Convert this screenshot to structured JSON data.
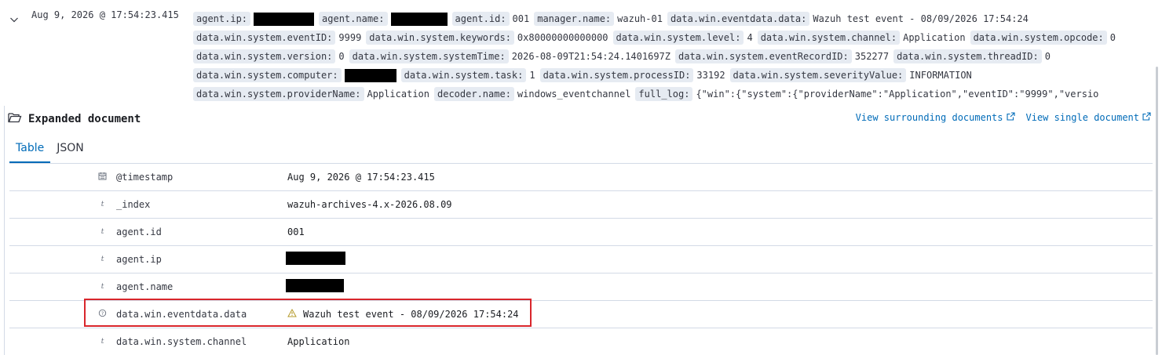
{
  "row": {
    "timestamp": "Aug 9, 2026 @ 17:54:23.415",
    "summary_lines": [
      [
        {
          "k": "agent.ip:",
          "redacted": true,
          "w": 77
        },
        {
          "k": "agent.name:",
          "redacted": true,
          "w": 72
        },
        {
          "k": "agent.id:",
          "v": "001"
        },
        {
          "k": "manager.name:",
          "v": "wazuh-01"
        },
        {
          "k": "data.win.eventdata.data:",
          "v": "Wazuh test event - 08/09/2026 17:54:24"
        }
      ],
      [
        {
          "k": "data.win.system.eventID:",
          "v": "9999"
        },
        {
          "k": "data.win.system.keywords:",
          "v": "0x80000000000000"
        },
        {
          "k": "data.win.system.level:",
          "v": "4"
        },
        {
          "k": "data.win.system.channel:",
          "v": "Application"
        },
        {
          "k": "data.win.system.opcode:",
          "v": "0"
        }
      ],
      [
        {
          "k": "data.win.system.version:",
          "v": "0"
        },
        {
          "k": "data.win.system.systemTime:",
          "v": "2026-08-09T21:54:24.1401697Z"
        },
        {
          "k": "data.win.system.eventRecordID:",
          "v": "352277"
        },
        {
          "k": "data.win.system.threadID:",
          "v": "0"
        }
      ],
      [
        {
          "k": "data.win.system.computer:",
          "redacted": true,
          "w": 66
        },
        {
          "k": "data.win.system.task:",
          "v": "1"
        },
        {
          "k": "data.win.system.processID:",
          "v": "33192"
        },
        {
          "k": "data.win.system.severityValue:",
          "v": "INFORMATION"
        }
      ],
      [
        {
          "k": "data.win.system.providerName:",
          "v": "Application"
        },
        {
          "k": "decoder.name:",
          "v": "windows_eventchannel"
        },
        {
          "k": "full_log:",
          "v": "{\"win\":{\"system\":{\"providerName\":\"Application\",\"eventID\":\"9999\",\"versio"
        }
      ]
    ]
  },
  "expanded": {
    "title": "Expanded document",
    "surrounding_link": "View surrounding documents",
    "single_link": "View single document"
  },
  "tabs": [
    {
      "label": "Table",
      "active": true
    },
    {
      "label": "JSON",
      "active": false
    }
  ],
  "fields": [
    {
      "icon": "calendar-icon",
      "name": "@timestamp",
      "value": "Aug 9, 2026 @ 17:54:23.415"
    },
    {
      "icon": "string-type-icon",
      "name": "_index",
      "value": "wazuh-archives-4.x-2026.08.09"
    },
    {
      "icon": "string-type-icon",
      "name": "agent.id",
      "value": "001"
    },
    {
      "icon": "string-type-icon",
      "name": "agent.ip",
      "value": "",
      "redacted": true,
      "w": 76
    },
    {
      "icon": "string-type-icon",
      "name": "agent.name",
      "value": "",
      "redacted": true,
      "w": 74
    },
    {
      "icon": "unknown-type-icon",
      "name": "data.win.eventdata.data",
      "value": "Wazuh test event - 08/09/2026 17:54:24",
      "warning": true
    },
    {
      "icon": "string-type-icon",
      "name": "data.win.system.channel",
      "value": "Application"
    }
  ],
  "colors": {
    "accent": "#006bb8",
    "highlight": "#d9262c",
    "warning": "#b59a2b"
  }
}
